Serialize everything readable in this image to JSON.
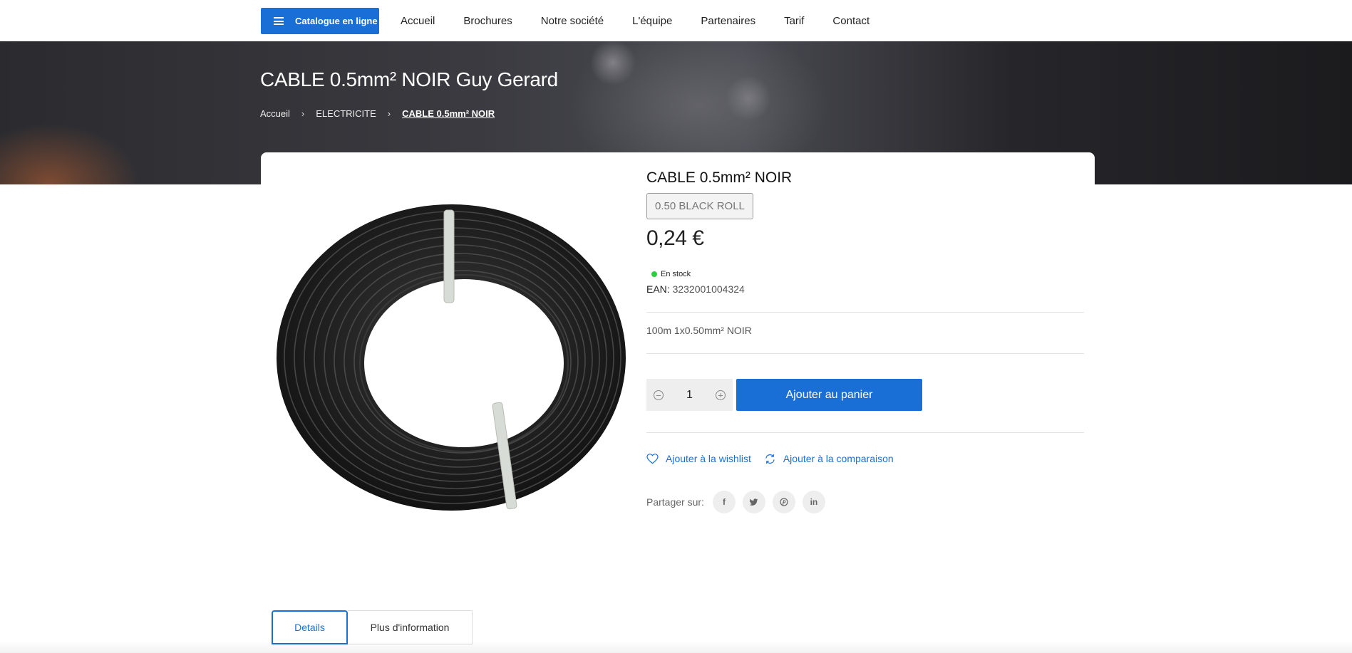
{
  "nav": {
    "catalog_label": "Catalogue en ligne",
    "links": [
      "Accueil",
      "Brochures",
      "Notre société",
      "L'équipe",
      "Partenaires",
      "Tarif",
      "Contact"
    ]
  },
  "hero": {
    "title": "CABLE 0.5mm² NOIR Guy Gerard",
    "breadcrumb": [
      "Accueil",
      "ELECTRICITE",
      "CABLE 0.5mm² NOIR"
    ]
  },
  "product": {
    "title": "CABLE 0.5mm² NOIR",
    "reference": "0.50 BLACK ROLL",
    "price": "0,24 €",
    "stock": "En stock",
    "ean_label": "EAN:",
    "ean_value": "3232001004324",
    "description": "100m 1x0.50mm² NOIR",
    "quantity": "1",
    "add_to_cart": "Ajouter au panier",
    "wishlist": "Ajouter à la wishlist",
    "compare": "Ajouter à la comparaison",
    "share_label": "Partager sur:",
    "share_icons": [
      "facebook-icon",
      "twitter-icon",
      "pinterest-icon",
      "linkedin-icon"
    ]
  },
  "tabs": [
    "Details",
    "Plus d'information"
  ],
  "colors": {
    "accent": "#1a6fd6",
    "stock_dot": "#2ecc40"
  }
}
